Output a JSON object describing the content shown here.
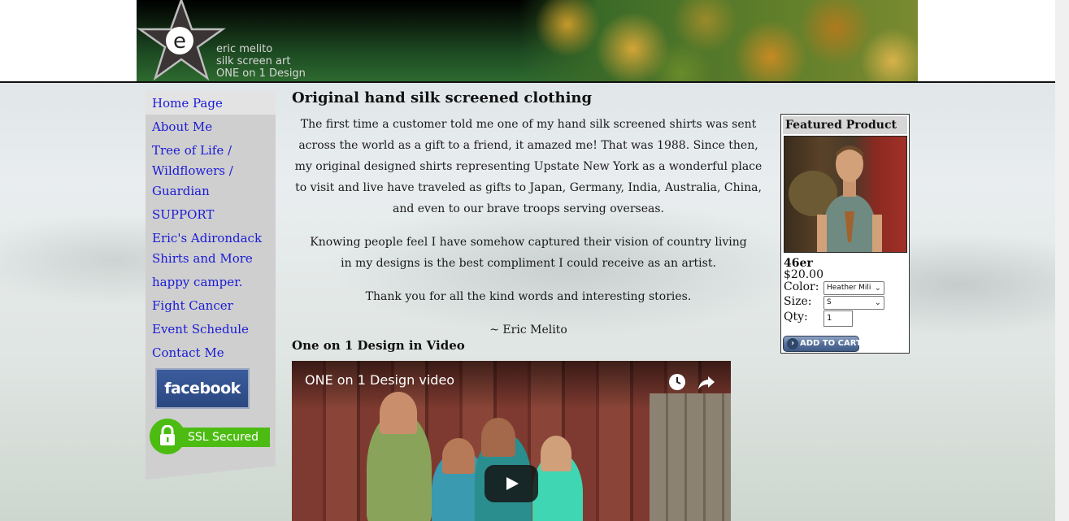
{
  "brand": {
    "lines": [
      "eric melito",
      "silk screen art",
      "ONE on 1 Design"
    ],
    "logo_letter": "e"
  },
  "sidebar": {
    "items": [
      {
        "label": "Home Page"
      },
      {
        "label": "About Me"
      },
      {
        "label": "Tree of Life / Wildflowers / Guardian"
      },
      {
        "label": "SUPPORT"
      },
      {
        "label": "Eric's Adirondack Shirts and More"
      },
      {
        "label": "happy camper."
      },
      {
        "label": "Fight Cancer"
      },
      {
        "label": "Event Schedule"
      },
      {
        "label": "Contact Me"
      }
    ],
    "facebook_label": "facebook",
    "ssl_label": "SSL Secured"
  },
  "main": {
    "title": "Original hand silk screened clothing",
    "paragraph1": "The first time a customer told me one of my hand silk screened shirts was sent across the world as a gift to a friend, it amazed me! That was 1988. Since then, my original designed shirts representing Upstate New York as a wonderful place to visit and live have traveled as gifts to Japan, Germany, India, Australia, China, and even to our brave troops serving overseas.",
    "paragraph2": "Knowing people feel I have somehow captured their vision of country living in my designs is the best compliment I could receive as an artist.",
    "paragraph3": "Thank you for all the kind words and interesting stories.",
    "signature": "~ Eric Melito",
    "video_heading": "One on 1 Design in Video",
    "video_title": "ONE on 1 Design video"
  },
  "featured": {
    "heading": "Featured Product",
    "name": "46er",
    "price": "$20.00",
    "color_label": "Color:",
    "color_value": "Heather Mili",
    "size_label": "Size:",
    "size_value": "S",
    "qty_label": "Qty:",
    "qty_value": "1",
    "add_to_cart": "ADD TO CART"
  },
  "icons": {
    "watch_later": "clock-icon",
    "share": "share-icon",
    "play": "play-icon",
    "lock": "lock-icon"
  }
}
